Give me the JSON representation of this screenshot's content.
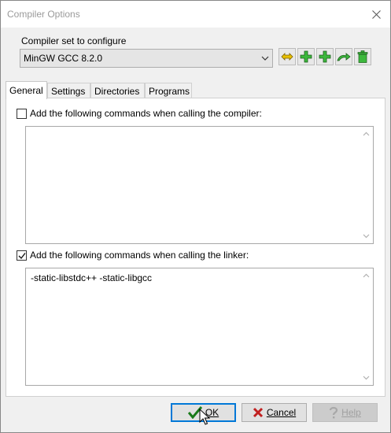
{
  "window": {
    "title": "Compiler Options"
  },
  "compiler_set": {
    "label": "Compiler set to configure",
    "selected": "MinGW GCC 8.2.0",
    "tools": [
      {
        "icon": "rename-icon",
        "color": "#d4a000"
      },
      {
        "icon": "add-icon",
        "color": "#2fa82f"
      },
      {
        "icon": "add-copy-icon",
        "color": "#2fa82f"
      },
      {
        "icon": "redo-icon",
        "color": "#2fa82f"
      },
      {
        "icon": "trash-icon",
        "color": "#2a8a2a"
      }
    ]
  },
  "tabs": [
    "General",
    "Settings",
    "Directories",
    "Programs"
  ],
  "active_tab": "General",
  "general": {
    "compiler_cmd": {
      "checked": false,
      "label": "Add the following commands when calling the compiler:",
      "text": ""
    },
    "linker_cmd": {
      "checked": true,
      "label": "Add the following commands when calling the linker:",
      "text": "-static-libstdc++ -static-libgcc"
    }
  },
  "footer": {
    "ok": "OK",
    "cancel": "Cancel",
    "help": "Help"
  },
  "colors": {
    "accent": "#0078d7",
    "ok_check": "#1a7a1a",
    "cancel_x": "#c02020"
  }
}
